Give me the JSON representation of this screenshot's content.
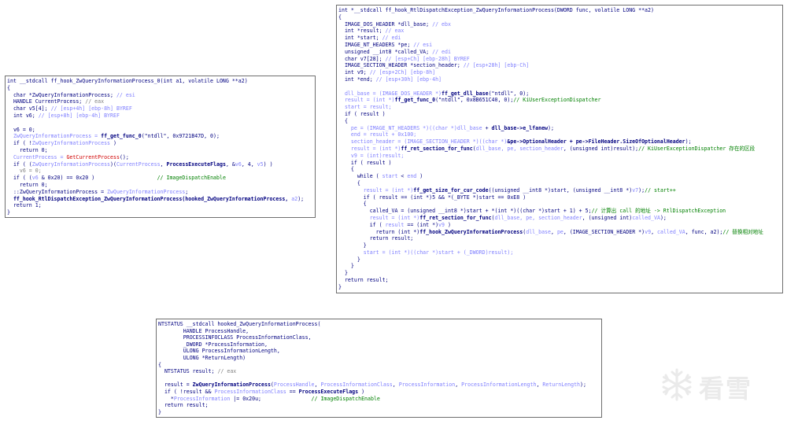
{
  "panels": [
    {
      "id": "panel-a",
      "name": "code-window-hook-zwqueryinformationprocess-0",
      "lines": [
        [
          [
            "int __stdcall ff_hook_ZwQueryInformationProcess_0(int a1, volatile LONG **a2)",
            "plain"
          ]
        ],
        [
          [
            "{",
            "plain"
          ]
        ],
        [
          [
            "  char *ZwQueryInformationProcess; ",
            "plain"
          ],
          [
            "// esi",
            "lbl"
          ]
        ],
        [
          [
            "  HANDLE CurrentProcess; ",
            "plain"
          ],
          [
            "// eax",
            "gray"
          ]
        ],
        [
          [
            "  char v5[4]; ",
            "plain"
          ],
          [
            "// [esp+4h] [ebp-8h] BYREF",
            "lbl"
          ]
        ],
        [
          [
            "  int v6; ",
            "plain"
          ],
          [
            "// [esp+8h] [ebp-4h] BYREF",
            "lbl"
          ]
        ],
        [
          [
            "",
            "plain"
          ]
        ],
        [
          [
            "  v6 = 0;",
            "plain"
          ]
        ],
        [
          [
            "  ZwQueryInformationProcess = ",
            "lbl"
          ],
          [
            "ff_get_func_0",
            "bold"
          ],
          [
            "(\"ntdll\", 0x9721B47D, 0);",
            "plain"
          ]
        ],
        [
          [
            "  if ( !",
            "plain"
          ],
          [
            "ZwQueryInformationProcess",
            "lbl"
          ],
          [
            " )",
            "plain"
          ]
        ],
        [
          [
            "    return 0;",
            "plain"
          ]
        ],
        [
          [
            "  CurrentProcess = ",
            "lbl"
          ],
          [
            "GetCurrentProcess",
            "red"
          ],
          [
            "();",
            "plain"
          ]
        ],
        [
          [
            "  if ( (",
            "plain"
          ],
          [
            "ZwQueryInformationProcess",
            "lbl"
          ],
          [
            ")(",
            "plain"
          ],
          [
            "CurrentProcess",
            "lbl"
          ],
          [
            ", ",
            "plain"
          ],
          [
            "ProcessExecuteFlags",
            "bold"
          ],
          [
            ", &",
            "plain"
          ],
          [
            "v6",
            "lbl"
          ],
          [
            ", 4, ",
            "plain"
          ],
          [
            "v5",
            "lbl"
          ],
          [
            ") )",
            "plain"
          ]
        ],
        [
          [
            "    v6 = 0;",
            "gray"
          ]
        ],
        [
          [
            "  if ( (",
            "plain"
          ],
          [
            "v6",
            "lbl"
          ],
          [
            " & 0x20) == 0x20 )                    ",
            "plain"
          ],
          [
            "// ImageDispatchEnable",
            "com"
          ]
        ],
        [
          [
            "    return 0;",
            "plain"
          ]
        ],
        [
          [
            "  ::ZwQueryInformationProcess = ",
            "plain"
          ],
          [
            "ZwQueryInformationProcess",
            "lbl"
          ],
          [
            ";",
            "plain"
          ]
        ],
        [
          [
            "  ff_hook_RtlDispatchException_ZwQueryInformationProcess(hooked_ZwQueryInformationProcess, ",
            "bold"
          ],
          [
            "a2",
            "lbl"
          ],
          [
            ");",
            "plain"
          ]
        ],
        [
          [
            "  return 1;",
            "plain"
          ]
        ],
        [
          [
            "}",
            "plain"
          ]
        ]
      ]
    },
    {
      "id": "panel-b",
      "name": "code-window-hook-rtldispatchexception",
      "lines": [
        [
          [
            "int *__stdcall ff_hook_RtlDispatchException_ZwQueryInformationProcess(DWORD func, volatile LONG **a2)",
            "plain"
          ]
        ],
        [
          [
            "{",
            "plain"
          ]
        ],
        [
          [
            "  IMAGE_DOS_HEADER *dll_base; ",
            "plain"
          ],
          [
            "// ebx",
            "lbl"
          ]
        ],
        [
          [
            "  int *result; ",
            "plain"
          ],
          [
            "// eax",
            "lbl"
          ]
        ],
        [
          [
            "  int *start; ",
            "plain"
          ],
          [
            "// edi",
            "lbl"
          ]
        ],
        [
          [
            "  IMAGE_NT_HEADERS *pe; ",
            "plain"
          ],
          [
            "// esi",
            "lbl"
          ]
        ],
        [
          [
            "  unsigned __int8 *called_VA; ",
            "plain"
          ],
          [
            "// edi",
            "lbl"
          ]
        ],
        [
          [
            "  char v7[28]; ",
            "plain"
          ],
          [
            "// [esp+Ch] [ebp-28h] BYREF",
            "lbl"
          ]
        ],
        [
          [
            "  IMAGE_SECTION_HEADER *section_header; ",
            "plain"
          ],
          [
            "// [esp+28h] [ebp-Ch]",
            "lbl"
          ]
        ],
        [
          [
            "  int v9; ",
            "plain"
          ],
          [
            "// [esp+2Ch] [ebp-8h]",
            "lbl"
          ]
        ],
        [
          [
            "  int *end; ",
            "plain"
          ],
          [
            "// [esp+30h] [ebp-4h]",
            "lbl"
          ]
        ],
        [
          [
            "",
            "plain"
          ]
        ],
        [
          [
            "  dll_base = (IMAGE_DOS_HEADER *)",
            "lbl"
          ],
          [
            "ff_get_dll_base",
            "bold"
          ],
          [
            "(\"ntdll\", 0);",
            "plain"
          ]
        ],
        [
          [
            "  result = (int *)",
            "lbl"
          ],
          [
            "ff_get_func_0",
            "bold"
          ],
          [
            "(\"ntdll\", 0x8B651C40, 0);",
            "plain"
          ],
          [
            "// KiUserExceptionDispatcher",
            "com"
          ]
        ],
        [
          [
            "  start = result;",
            "lbl"
          ]
        ],
        [
          [
            "  if ( result )",
            "plain"
          ]
        ],
        [
          [
            "  {",
            "plain"
          ]
        ],
        [
          [
            "    pe = (IMAGE_NT_HEADERS *)((char *)",
            "lbl"
          ],
          [
            "dll_base",
            "lbl"
          ],
          [
            " + ",
            "plain"
          ],
          [
            "dll_base->e_lfanew",
            "bold"
          ],
          [
            ");",
            "plain"
          ]
        ],
        [
          [
            "    end = result + 0x100;",
            "lbl"
          ]
        ],
        [
          [
            "    section_header = (IMAGE_SECTION_HEADER *)((char *)",
            "lbl"
          ],
          [
            "&pe->OptionalHeader + pe->FileHeader.SizeOfOptionalHeader",
            "bold"
          ],
          [
            ");",
            "plain"
          ]
        ],
        [
          [
            "    result = (int *)",
            "lbl"
          ],
          [
            "ff_ret_section_for_func",
            "bold"
          ],
          [
            "(",
            "plain"
          ],
          [
            "dll_base, pe, section_header",
            "lbl"
          ],
          [
            ", (unsigned int)result);",
            "plain"
          ],
          [
            "// KiUserExceptionDispatcher 存在的区段",
            "com"
          ]
        ],
        [
          [
            "    v9 = (int)result;",
            "lbl"
          ]
        ],
        [
          [
            "    if ( result )",
            "plain"
          ]
        ],
        [
          [
            "    {",
            "plain"
          ]
        ],
        [
          [
            "      while ( ",
            "plain"
          ],
          [
            "start",
            "lbl"
          ],
          [
            " < ",
            "plain"
          ],
          [
            "end",
            "lbl"
          ],
          [
            " )",
            "plain"
          ]
        ],
        [
          [
            "      {",
            "plain"
          ]
        ],
        [
          [
            "        result = (int *)",
            "lbl"
          ],
          [
            "ff_get_size_for_cur_code",
            "bold"
          ],
          [
            "((unsigned __int8 *)start, (unsigned __int8 *)",
            "plain"
          ],
          [
            "v7",
            "lbl"
          ],
          [
            ");",
            "plain"
          ],
          [
            "// start++",
            "com"
          ]
        ],
        [
          [
            "        if ( result == (int *)5 && *(_BYTE *)start == 0xE8 )",
            "plain"
          ]
        ],
        [
          [
            "        {",
            "plain"
          ]
        ],
        [
          [
            "          called_VA = (unsigned __int8 *)start + *(int *)((char *)start + 1) + 5;",
            "plain"
          ],
          [
            "// 计算出 call 的地址 -> RtlDispatchException",
            "com"
          ]
        ],
        [
          [
            "          result = (int *)",
            "lbl"
          ],
          [
            "ff_ret_section_for_func",
            "bold"
          ],
          [
            "(",
            "plain"
          ],
          [
            "dll_base, pe, section_header",
            "lbl"
          ],
          [
            ", (unsigned int)",
            "plain"
          ],
          [
            "called_VA",
            "lbl"
          ],
          [
            ");",
            "plain"
          ]
        ],
        [
          [
            "          if ( ",
            "plain"
          ],
          [
            "result",
            "lbl"
          ],
          [
            " == (int *)",
            "plain"
          ],
          [
            "v9",
            "lbl"
          ],
          [
            " )",
            "plain"
          ]
        ],
        [
          [
            "            return (int *)",
            "plain"
          ],
          [
            "ff_hook_ZwQueryInformationProcess",
            "bold"
          ],
          [
            "(",
            "plain"
          ],
          [
            "dll_base",
            "lbl"
          ],
          [
            ", ",
            "plain"
          ],
          [
            "pe",
            "lbl"
          ],
          [
            ", (IMAGE_SECTION_HEADER *)",
            "plain"
          ],
          [
            "v9",
            "lbl"
          ],
          [
            ", ",
            "plain"
          ],
          [
            "called_VA",
            "lbl"
          ],
          [
            ", func, a2);",
            "plain"
          ],
          [
            "// 替换相对地址",
            "com"
          ]
        ],
        [
          [
            "          return result;",
            "plain"
          ]
        ],
        [
          [
            "        }",
            "plain"
          ]
        ],
        [
          [
            "        start = (int *)((char *)start + (_DWORD)result);",
            "lbl"
          ]
        ],
        [
          [
            "      }",
            "plain"
          ]
        ],
        [
          [
            "    }",
            "plain"
          ]
        ],
        [
          [
            "  }",
            "plain"
          ]
        ],
        [
          [
            "  return result;",
            "plain"
          ]
        ],
        [
          [
            "}",
            "plain"
          ]
        ]
      ]
    },
    {
      "id": "panel-c",
      "name": "code-window-hooked-zwqueryinformationprocess",
      "lines": [
        [
          [
            "NTSTATUS __stdcall hooked_ZwQueryInformationProcess(",
            "plain"
          ]
        ],
        [
          [
            "        HANDLE ProcessHandle,",
            "plain"
          ]
        ],
        [
          [
            "        PROCESSINFOCLASS ProcessInformationClass,",
            "plain"
          ]
        ],
        [
          [
            "        _DWORD *ProcessInformation,",
            "plain"
          ]
        ],
        [
          [
            "        ULONG ProcessInformationLength,",
            "plain"
          ]
        ],
        [
          [
            "        ULONG *ReturnLength)",
            "plain"
          ]
        ],
        [
          [
            "{",
            "plain"
          ]
        ],
        [
          [
            "  NTSTATUS result; ",
            "plain"
          ],
          [
            "// eax",
            "gray"
          ]
        ],
        [
          [
            "",
            "plain"
          ]
        ],
        [
          [
            "  result = ",
            "plain"
          ],
          [
            "ZwQueryInformationProcess",
            "bold"
          ],
          [
            "(",
            "plain"
          ],
          [
            "ProcessHandle",
            "lbl"
          ],
          [
            ", ",
            "plain"
          ],
          [
            "ProcessInformationClass",
            "lbl"
          ],
          [
            ", ",
            "plain"
          ],
          [
            "ProcessInformation",
            "lbl"
          ],
          [
            ", ",
            "plain"
          ],
          [
            "ProcessInformationLength",
            "lbl"
          ],
          [
            ", ",
            "plain"
          ],
          [
            "ReturnLength",
            "lbl"
          ],
          [
            ");",
            "plain"
          ]
        ],
        [
          [
            "  if ( !result && ",
            "plain"
          ],
          [
            "ProcessInformationClass",
            "lbl"
          ],
          [
            " == ",
            "plain"
          ],
          [
            "ProcessExecuteFlags",
            "bold"
          ],
          [
            " )",
            "plain"
          ]
        ],
        [
          [
            "    *",
            "plain"
          ],
          [
            "ProcessInformation",
            "lbl"
          ],
          [
            " |= 0x20u;                ",
            "plain"
          ],
          [
            "// ImageDispatchEnable",
            "com"
          ]
        ],
        [
          [
            "  return result;",
            "plain"
          ]
        ],
        [
          [
            "}",
            "plain"
          ]
        ]
      ]
    }
  ],
  "watermark": {
    "text": "看雪",
    "icon": "snowflake-icon",
    "color": "#eaeaea"
  }
}
